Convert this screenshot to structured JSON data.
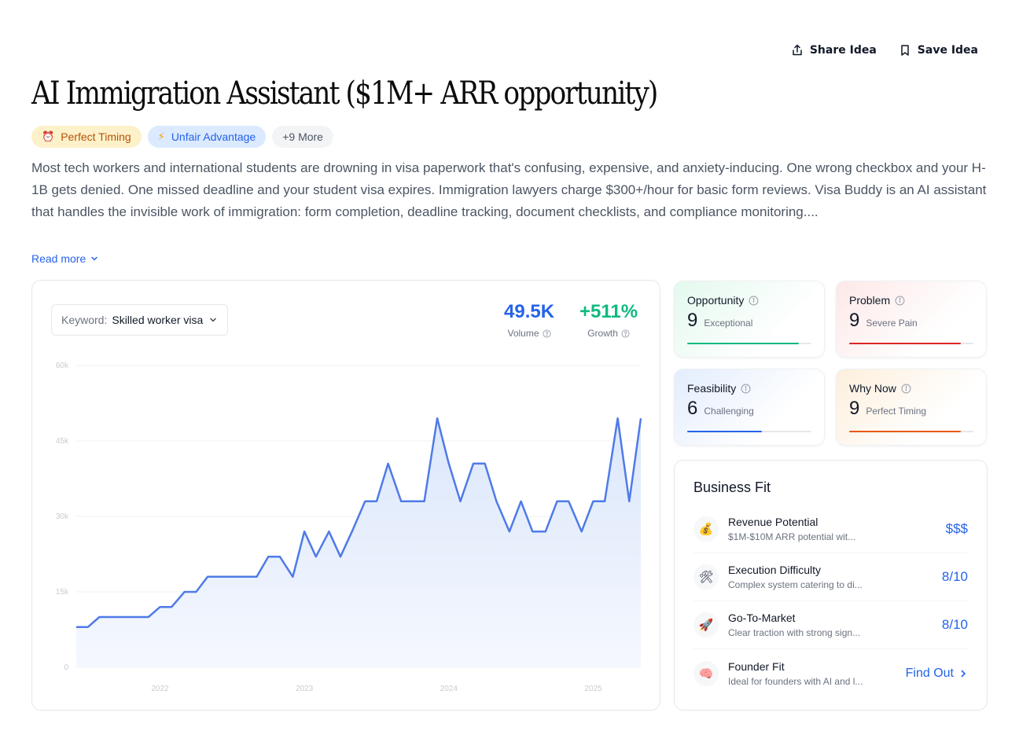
{
  "actions": {
    "share_label": "Share Idea",
    "save_label": "Save Idea"
  },
  "title": "AI Immigration Assistant ($1M+ ARR opportunity)",
  "tags": [
    {
      "icon": "alarm-clock-icon",
      "label": "Perfect Timing"
    },
    {
      "icon": "lightning-icon",
      "label": "Unfair Advantage"
    },
    {
      "label": "+9 More"
    }
  ],
  "description": "Most tech workers and international students are drowning in visa paperwork that's confusing, expensive, and anxiety-inducing. One wrong checkbox and your H-1B gets denied. One missed deadline and your student visa expires. Immigration lawyers charge $300+/hour for basic form reviews. Visa Buddy is an AI assistant that handles the invisible work of immigration: form completion, deadline tracking, document checklists, and compliance monitoring....",
  "read_more": "Read more",
  "keyword": {
    "label": "Keyword:",
    "value": "Skilled worker visa"
  },
  "metrics": {
    "volume": {
      "value": "49.5K",
      "label": "Volume"
    },
    "growth": {
      "value": "+511%",
      "label": "Growth"
    }
  },
  "chart_data": {
    "type": "area",
    "ylim": [
      0,
      60000
    ],
    "yticks": [
      0,
      15000,
      30000,
      45000,
      60000
    ],
    "ytick_labels": [
      "0",
      "15k",
      "30k",
      "45k",
      "60k"
    ],
    "xlim": [
      2021.42,
      2025.33
    ],
    "xticks": [
      2022,
      2023,
      2024,
      2025
    ],
    "xtick_labels": [
      "2022",
      "2023",
      "2024",
      "2025"
    ],
    "grid": true,
    "series": [
      {
        "x": [
          2021.42,
          2021.5,
          2021.58,
          2021.67,
          2021.75,
          2021.83,
          2021.92,
          2022.0,
          2022.08,
          2022.17,
          2022.25,
          2022.33,
          2022.42,
          2022.5,
          2022.58,
          2022.67,
          2022.75,
          2022.83,
          2022.92,
          2023.0,
          2023.08,
          2023.17,
          2023.25,
          2023.33,
          2023.42,
          2023.5,
          2023.58,
          2023.67,
          2023.75,
          2023.83,
          2023.92,
          2024.0,
          2024.08,
          2024.17,
          2024.25,
          2024.33,
          2024.42,
          2024.5,
          2024.58,
          2024.67,
          2024.75,
          2024.83,
          2024.92,
          2025.0,
          2025.08,
          2025.17,
          2025.25,
          2025.33
        ],
        "values": [
          8000,
          8000,
          10000,
          10000,
          10000,
          10000,
          10000,
          12000,
          12000,
          15000,
          15000,
          18000,
          18000,
          18000,
          18000,
          18000,
          22000,
          22000,
          18000,
          27000,
          22000,
          27000,
          22000,
          27000,
          33000,
          33000,
          40500,
          33000,
          33000,
          33000,
          49500,
          40500,
          33000,
          40500,
          40500,
          33000,
          27000,
          33000,
          27000,
          27000,
          33000,
          33000,
          27000,
          33000,
          33000,
          49500,
          33000,
          49500
        ]
      }
    ]
  },
  "scores": [
    {
      "title": "Opportunity",
      "score": "9",
      "label": "Exceptional",
      "fraction": 0.9,
      "color": "#10b981"
    },
    {
      "title": "Problem",
      "score": "9",
      "label": "Severe Pain",
      "fraction": 0.9,
      "color": "#dc2626"
    },
    {
      "title": "Feasibility",
      "score": "6",
      "label": "Challenging",
      "fraction": 0.6,
      "color": "#2563eb"
    },
    {
      "title": "Why Now",
      "score": "9",
      "label": "Perfect Timing",
      "fraction": 0.9,
      "color": "#ea580c"
    }
  ],
  "business_fit": {
    "title": "Business Fit",
    "rows": [
      {
        "icon": "money-bag-icon",
        "name": "Revenue Potential",
        "sub": "$1M-$10M ARR potential wit...",
        "value": "$$$"
      },
      {
        "icon": "tools-icon",
        "name": "Execution Difficulty",
        "sub": "Complex system catering to di...",
        "value": "8/10"
      },
      {
        "icon": "rocket-icon",
        "name": "Go-To-Market",
        "sub": "Clear traction with strong sign...",
        "value": "8/10"
      },
      {
        "icon": "brain-icon",
        "name": "Founder Fit",
        "sub": "Ideal for founders with AI and l...",
        "value": "Find Out"
      }
    ]
  }
}
